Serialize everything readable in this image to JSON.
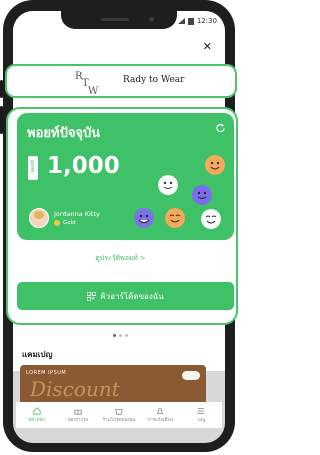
{
  "status": {
    "time": "12:30"
  },
  "brand": {
    "name": "Rady to Wear",
    "logo_text": "RTW"
  },
  "points_card": {
    "title": "พอยท์ปัจจุบัน",
    "tag": "พอยท์",
    "value": "1,000",
    "user_name": "Jordanna Kitty",
    "tier": "Gold"
  },
  "history_link": "ดูประวัติพอยท์ >",
  "qr_button": "คิวอาร์โค้ดของฉัน",
  "campaign": {
    "label": "แคมเปญ",
    "banner_small": "LOREM IPSUM",
    "banner_big": "Discount"
  },
  "tabs": [
    {
      "label": "หน้าหลัก",
      "active": true
    },
    {
      "label": "ของรางวัล",
      "active": false
    },
    {
      "label": "ร้านโปรดของฉัน",
      "active": false
    },
    {
      "label": "การแจ้งเตือน",
      "active": false
    },
    {
      "label": "เมนู",
      "active": false
    }
  ],
  "colors": {
    "primary": "#3fc267",
    "frame": "#1e1e1e",
    "highlight_border": "#4cc46a"
  }
}
